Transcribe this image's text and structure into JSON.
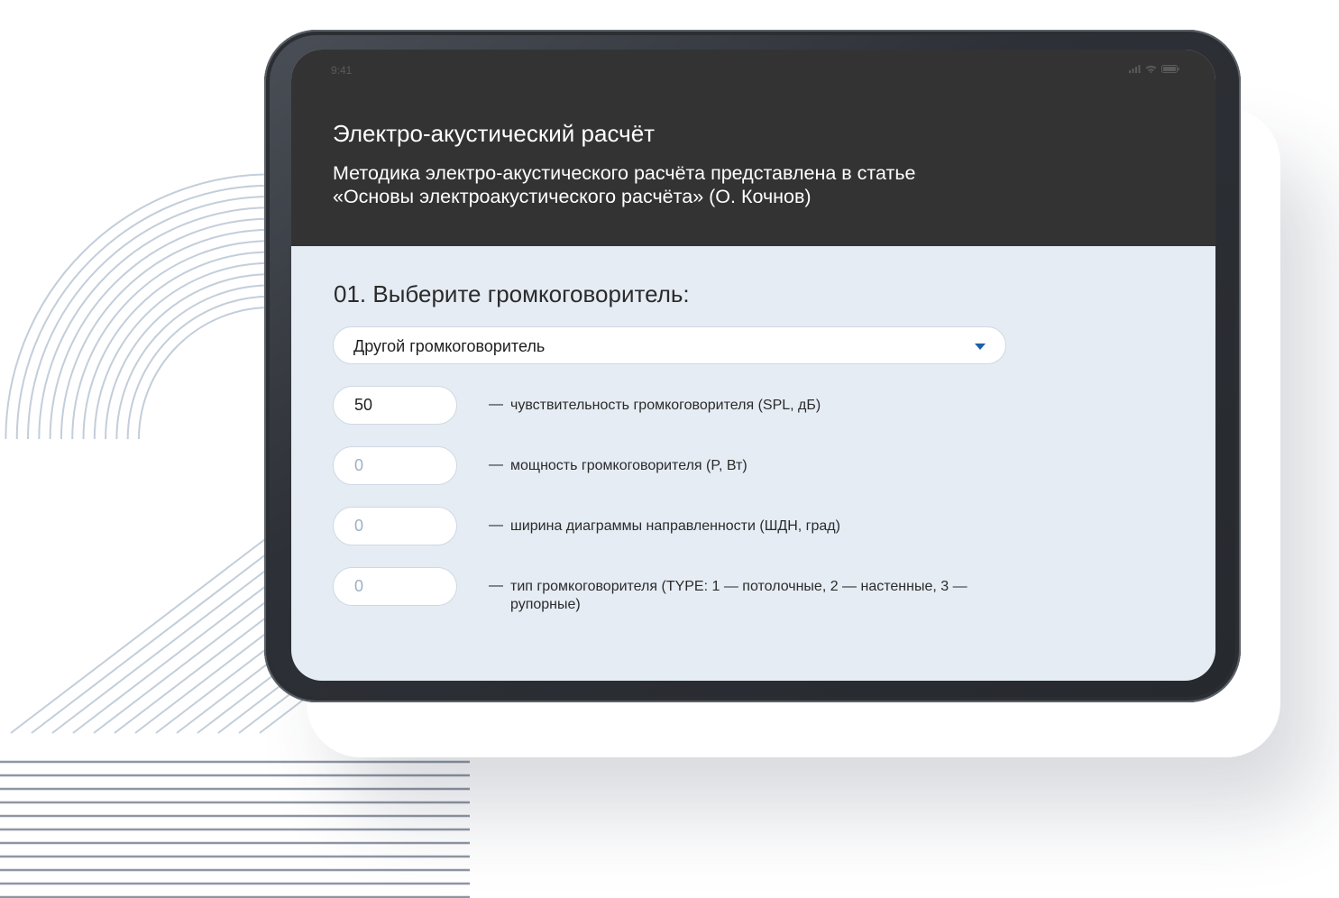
{
  "status_bar": {
    "time": "9:41"
  },
  "header": {
    "title": "Электро-акустический расчёт",
    "subtitle_line1": "Методика электро-акустического расчёта представлена в статье",
    "subtitle_line2": "«Основы электроакустического расчёта» (О. Кочнов)"
  },
  "step1": {
    "title": "01. Выберите громкоговоритель:",
    "speaker_select": {
      "selected": "Другой громкоговоритель"
    },
    "fields": [
      {
        "value": "50",
        "placeholder": "0",
        "dash": "—",
        "label": "чувствительность громкоговорителя (SPL, дБ)"
      },
      {
        "value": "",
        "placeholder": "0",
        "dash": "—",
        "label": "мощность громкоговорителя (P, Вт)"
      },
      {
        "value": "",
        "placeholder": "0",
        "dash": "—",
        "label": "ширина диаграммы направленности (ШДН, град)"
      },
      {
        "value": "",
        "placeholder": "0",
        "dash": "—",
        "label": "тип громкоговорителя (TYPE: 1 — потолочные, 2 — настенные, 3 — рупорные)"
      }
    ]
  },
  "colors": {
    "header_bg": "#333333",
    "screen_bg": "#e5ecf4",
    "accent": "#1d5fa8",
    "decor_arc": "#c3ceda",
    "decor_lines": "#8f96a3"
  },
  "icons": [
    "signal-icon",
    "wifi-icon",
    "battery-icon",
    "chevron-down-icon"
  ]
}
